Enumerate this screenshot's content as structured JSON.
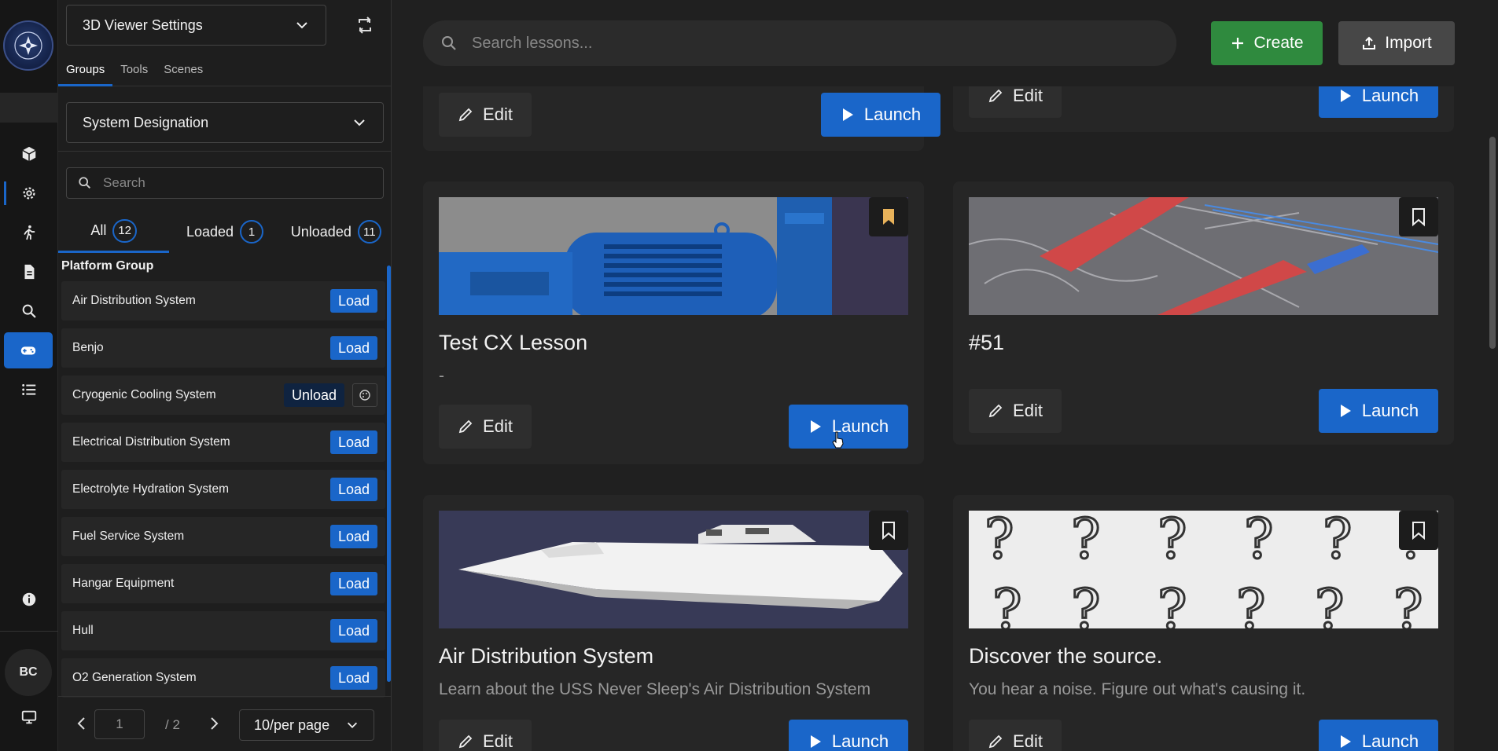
{
  "rail": {
    "avatar_initials": "BC",
    "icons": [
      "cube-icon",
      "gear-icon",
      "walk-icon",
      "document-icon",
      "search-icon",
      "gamepad-icon",
      "list-icon",
      "info-icon",
      "monitor-icon"
    ]
  },
  "panel": {
    "title": "3D Viewer Settings",
    "tabs": [
      "Groups",
      "Tools",
      "Scenes"
    ],
    "group_select": "System Designation",
    "search_placeholder": "Search",
    "filters": [
      {
        "label": "All",
        "count": "12"
      },
      {
        "label": "Loaded",
        "count": "1"
      },
      {
        "label": "Unloaded",
        "count": "11"
      }
    ],
    "group_header": "Platform Group",
    "items": [
      {
        "name": "Air Distribution System",
        "action": "Load"
      },
      {
        "name": "Benjo",
        "action": "Load"
      },
      {
        "name": "Cryogenic Cooling System",
        "action": "Unload"
      },
      {
        "name": "Electrical Distribution System",
        "action": "Load"
      },
      {
        "name": "Electrolyte Hydration System",
        "action": "Load"
      },
      {
        "name": "Fuel Service System",
        "action": "Load"
      },
      {
        "name": "Hangar Equipment",
        "action": "Load"
      },
      {
        "name": "Hull",
        "action": "Load"
      },
      {
        "name": "O2 Generation System",
        "action": "Load"
      }
    ],
    "pager": {
      "page": "1",
      "total": "/ 2",
      "page_size": "10/per page"
    }
  },
  "main": {
    "search_placeholder": "Search lessons...",
    "create_label": "Create",
    "import_label": "Import",
    "edit_label": "Edit",
    "launch_label": "Launch",
    "cards": [
      {
        "title": "Test CX Lesson",
        "desc": "-",
        "bookmarked": true
      },
      {
        "title": "#51",
        "desc": "",
        "bookmarked": false
      },
      {
        "title": "Air Distribution System",
        "desc": "Learn about the USS Never Sleep's Air Distribution System",
        "bookmarked": false
      },
      {
        "title": "Discover the source.",
        "desc": "You hear a noise. Figure out what's causing it.",
        "bookmarked": false
      }
    ]
  },
  "colors": {
    "accent": "#1a66c9",
    "create": "#2f8a3e",
    "bookmark_active": "#e8b25a"
  }
}
